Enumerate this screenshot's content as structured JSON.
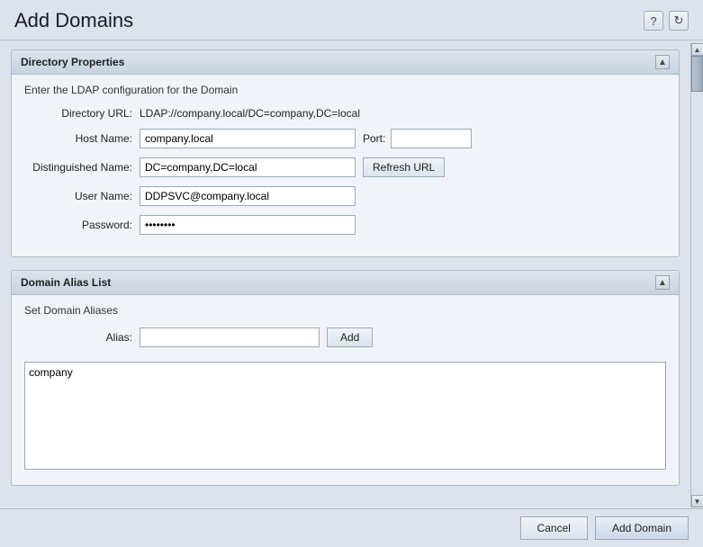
{
  "header": {
    "title": "Add Domains",
    "help_icon": "?",
    "refresh_icon": "↻"
  },
  "directory_panel": {
    "title": "Directory Properties",
    "collapse_icon": "▲",
    "subtitle": "Enter the LDAP configuration for the Domain",
    "fields": {
      "directory_url_label": "Directory URL:",
      "directory_url_value": "LDAP://company.local/DC=company,DC=local",
      "hostname_label": "Host Name:",
      "hostname_value": "company.local",
      "port_label": "Port:",
      "port_value": "",
      "dn_label": "Distinguished Name:",
      "dn_value": "DC=company,DC=local",
      "refresh_url_label": "Refresh URL",
      "username_label": "User Name:",
      "username_value": "DDPSVC@company.local",
      "password_label": "Password:",
      "password_value": "••••••••"
    }
  },
  "alias_panel": {
    "title": "Domain Alias List",
    "collapse_icon": "▲",
    "subtitle": "Set Domain Aliases",
    "alias_label": "Alias:",
    "alias_input_value": "",
    "add_button_label": "Add",
    "alias_list_content": "company"
  },
  "footer": {
    "cancel_label": "Cancel",
    "add_domain_label": "Add Domain"
  }
}
